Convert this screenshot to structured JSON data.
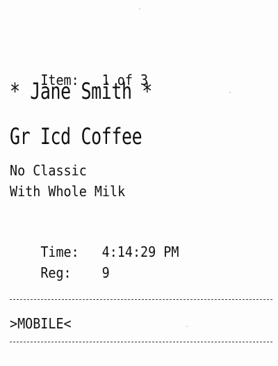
{
  "receipt": {
    "item_label": "Item:",
    "item_value": "1 of 3",
    "customer_name": "* Jane Smith *",
    "product": "Gr Icd Coffee",
    "modifiers": [
      "No Classic",
      "With Whole Milk"
    ],
    "time_label": "Time:",
    "time_value": "4:14:29 PM",
    "reg_label": "Reg:",
    "reg_value": "9",
    "channel": ">MOBILE<"
  }
}
